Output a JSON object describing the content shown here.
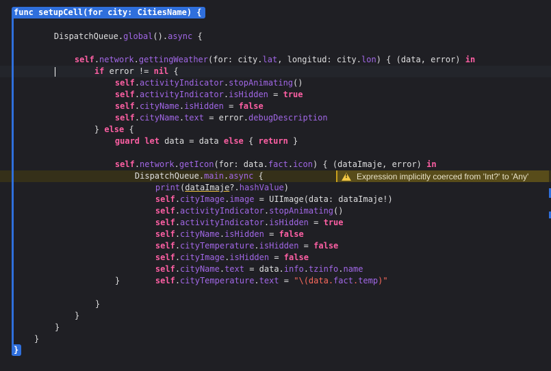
{
  "editor": {
    "header_line": "func setupCell(for city: CitiesName) {",
    "closing_brace": "}",
    "lines": {
      "l1": [
        "DispatchQueue",
        ".",
        "global",
        "().",
        "async",
        " {"
      ],
      "l2": [
        "self",
        ".",
        "network",
        ".",
        "gettingWeather",
        "(for: city.",
        "lat",
        ", longitud: city.",
        "lon",
        ") { (data, error) ",
        "in"
      ],
      "l3": [
        "if",
        " error != ",
        "nil",
        " {"
      ],
      "l4": [
        "self",
        ".",
        "activityIndicator",
        ".",
        "stopAnimating",
        "()"
      ],
      "l5": [
        "self",
        ".",
        "activityIndicator",
        ".",
        "isHidden",
        " = ",
        "true"
      ],
      "l6": [
        "self",
        ".",
        "cityName",
        ".",
        "isHidden",
        " = ",
        "false"
      ],
      "l7": [
        "self",
        ".",
        "cityName",
        ".",
        "text",
        " = error.",
        "debugDescription"
      ],
      "l8": [
        "} ",
        "else",
        " {"
      ],
      "l9": [
        "guard",
        " ",
        "let",
        " data = data ",
        "else",
        " { ",
        "return",
        " }"
      ],
      "l10": [
        "self",
        ".",
        "network",
        ".",
        "getIcon",
        "(for: data.",
        "fact",
        ".",
        "icon",
        ") { (dataImaje, error) ",
        "in"
      ],
      "l11": [
        "DispatchQueue",
        ".",
        "main",
        ".",
        "async",
        " {"
      ],
      "l12": [
        "print",
        "(",
        "dataImaje",
        "?.",
        "hashValue",
        ")"
      ],
      "l13": [
        "self",
        ".",
        "cityImage",
        ".",
        "image",
        " = ",
        "UIImage",
        "(data: dataImaje!)"
      ],
      "l14": [
        "self",
        ".",
        "activityIndicator",
        ".",
        "stopAnimating",
        "()"
      ],
      "l15": [
        "self",
        ".",
        "activityIndicator",
        ".",
        "isHidden",
        " = ",
        "true"
      ],
      "l16": [
        "self",
        ".",
        "cityName",
        ".",
        "isHidden",
        " = ",
        "false"
      ],
      "l17": [
        "self",
        ".",
        "cityTemperature",
        ".",
        "isHidden",
        " = ",
        "false"
      ],
      "l18": [
        "self",
        ".",
        "cityImage",
        ".",
        "isHidden",
        " = ",
        "false"
      ],
      "l19": [
        "self",
        ".",
        "cityName",
        ".",
        "text",
        " = data.",
        "info",
        ".",
        "tzinfo",
        ".",
        "name"
      ],
      "l20": [
        "self",
        ".",
        "cityTemperature",
        ".",
        "text",
        " = ",
        "\"\\(data.",
        "fact",
        ".",
        "temp",
        ")\""
      ],
      "b1": "}",
      "b2": "}",
      "b3": "}",
      "b4": "}",
      "b5": "}"
    },
    "warning": {
      "icon": "warning-triangle-icon",
      "message": "Expression implicitly coerced from 'Int?' to 'Any'"
    }
  },
  "colors": {
    "background": "#1f1f24",
    "keyword": "#fc5fa3",
    "property": "#a167e6",
    "plain": "#dfdfe0",
    "string": "#fc6a5d",
    "scope_highlight": "#2f6fdc",
    "warning": "#f2c744"
  }
}
